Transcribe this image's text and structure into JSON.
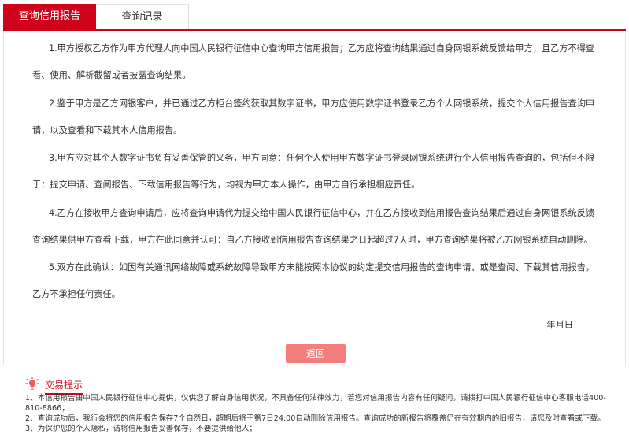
{
  "tabs": [
    {
      "label": "查询信用报告",
      "active": true
    },
    {
      "label": "查询记录",
      "active": false
    }
  ],
  "agreement": {
    "paragraphs": [
      "1.甲方授权乙方作为甲方代理人向中国人民银行征信中心查询甲方信用报告；乙方应将查询结果通过自身网银系统反馈给甲方，且乙方不得查看、使用、解析截留或者披露查询结果。",
      "2.鉴于甲方是乙方网银客户，并已通过乙方柜台签约获取其数字证书，甲方应使用数字证书登录乙方个人网银系统，提交个人信用报告查询申请，以及查看和下载其本人信用报告。",
      "3.甲方应对其个人数字证书负有妥善保管的义务，甲方同意：任何个人使用甲方数字证书登录网银系统进行个人信用报告查询的，包括但不限于：提交申请、查阅报告、下载信用报告等行为，均视为甲方本人操作，由甲方自行承担相应责任。",
      "4.乙方在接收甲方查询申请后，应将查询申请代为提交给中国人民银行征信中心，并在乙方接收到信用报告查询结果后通过自身网银系统反馈查询结果供甲方查看下载，甲方在此同意并认可：自乙方接收到信用报告查询结果之日起超过7天时，甲方查询结果将被乙方网银系统自动删除。",
      "5.双方在此确认：如因有关通讯网络故障或系统故障导致甲方未能按照本协议的约定提交信用报告的查询申请、或是查阅、下载其信用报告，乙方不承担任何责任。"
    ],
    "date_label": "年月日"
  },
  "back_button": {
    "label": "返回"
  },
  "tips": {
    "icon": "lightbulb-icon",
    "title": "交易提示",
    "items": [
      "1、本信用报告由中国人民银行征信中心提供，仅供您了解自身信用状况，不具备任何法律效力，若您对信用报告内容有任何疑问，请拨打中国人民银行征信中心客服电话400-810-8866；",
      "2、查询成功后，我行会将您的信用报告保存7个自然日，超期后将于第7日24:00自动删除信用报告。查询成功的新报告将覆盖仍在有效期内的旧报告，请您及时查看或下载。",
      "3、为保护您的个人隐私，请将信用报告妥善保存，不要提供给他人；"
    ]
  },
  "colors": {
    "accent": "#d0021b",
    "button": "#f47e7e",
    "text": "#333333"
  }
}
